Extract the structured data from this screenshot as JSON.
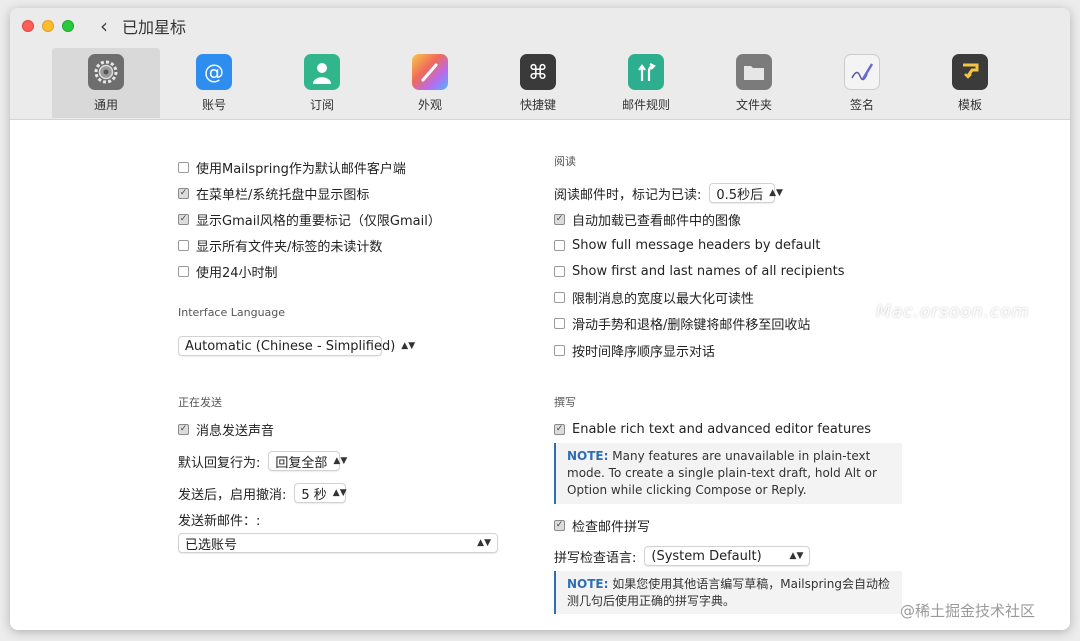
{
  "window": {
    "title": "已加星标"
  },
  "tabs": [
    {
      "label": "通用",
      "icon": "gear-icon",
      "color": "#6e6e6e"
    },
    {
      "label": "账号",
      "icon": "at-sign-icon",
      "color": "#2d8ef0"
    },
    {
      "label": "订阅",
      "icon": "person-icon",
      "color": "#31b58a"
    },
    {
      "label": "外观",
      "icon": "paintbrush-icon",
      "color": "#f06a5a"
    },
    {
      "label": "快捷键",
      "icon": "command-icon",
      "color": "#3a3a3a"
    },
    {
      "label": "邮件规则",
      "icon": "rules-arrows-icon",
      "color": "#2dae8f"
    },
    {
      "label": "文件夹",
      "icon": "folder-icon",
      "color": "#7b7b7b"
    },
    {
      "label": "签名",
      "icon": "signature-pen-icon",
      "color": "#f2f2f2"
    },
    {
      "label": "模板",
      "icon": "template-icon",
      "color": "#3b3b3b"
    }
  ],
  "general": {
    "default_client": "使用Mailspring作为默认邮件客户端",
    "menubar_icon": "在菜单栏/系统托盘中显示图标",
    "gmail_important": "显示Gmail风格的重要标记（仅限Gmail）",
    "unread_counts": "显示所有文件夹/标签的未读计数",
    "time24": "使用24小时制",
    "lang_heading": "Interface Language",
    "lang_value": "Automatic (Chinese - Simplified)"
  },
  "sending": {
    "heading": "正在发送",
    "sound": "消息发送声音",
    "reply_label": "默认回复行为:",
    "reply_value": "回复全部",
    "undo_label": "发送后，启用撤消:",
    "undo_value": "5 秒",
    "new_mail_label": "发送新邮件：:",
    "new_mail_value": "已选账号"
  },
  "reading": {
    "heading": "阅读",
    "mark_read_label": "阅读邮件时，标记为已读:",
    "mark_read_value": "0.5秒后",
    "auto_load_images": "自动加载已查看邮件中的图像",
    "full_headers": "Show full message headers by default",
    "full_names": "Show first and last names of all recipients",
    "limit_width": "限制消息的宽度以最大化可读性",
    "swipe_trash": "滑动手势和退格/删除键将邮件移至回收站",
    "reverse_order": "按时间降序顺序显示对话"
  },
  "composing": {
    "heading": "撰写",
    "rich_text": "Enable rich text and advanced editor features",
    "note1_prefix": "NOTE:",
    "note1_text": " Many features are unavailable in plain-text mode. To create a single plain-text draft, hold Alt or Option while clicking Compose or Reply.",
    "spellcheck": "检查邮件拼写",
    "spell_lang_label": "拼写检查语言:",
    "spell_lang_value": "(System Default)",
    "note2_prefix": "NOTE:",
    "note2_text": " 如果您使用其他语言编写草稿，Mailspring会自动检测几句后使用正确的拼写字典。"
  },
  "watermarks": {
    "mac": "Mac.orsoon.com",
    "juejin": "@稀土掘金技术社区"
  }
}
